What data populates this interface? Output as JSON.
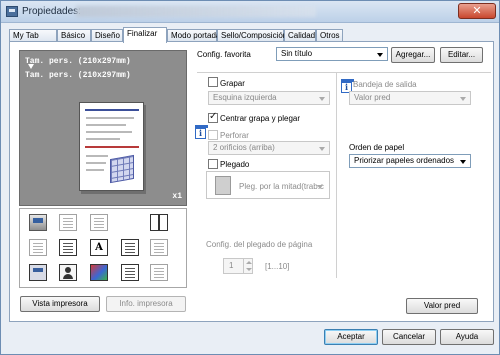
{
  "window": {
    "title": "Propiedades:",
    "close_label": "✕"
  },
  "tabs": [
    {
      "label": "My Tab"
    },
    {
      "label": "Básico"
    },
    {
      "label": "Diseño"
    },
    {
      "label": "Finalizar"
    },
    {
      "label": "Modo portada"
    },
    {
      "label": "Sello/Composición"
    },
    {
      "label": "Calidad"
    },
    {
      "label": "Otros"
    }
  ],
  "preview": {
    "line1": "Tam. pers. (210x297mm)",
    "line2": "Tam. pers. (210x297mm)",
    "copies": "x1"
  },
  "left_buttons": {
    "printer_view": "Vista impresora",
    "printer_info": "Info. impresora"
  },
  "config": {
    "label": "Config. favorita",
    "selected": "Sin título",
    "add_button": "Agregar...",
    "edit_button": "Editar..."
  },
  "staple": {
    "label": "Grapar",
    "position": "Esquina izquierda",
    "center_label": "Centrar grapa y plegar",
    "punch_label": "Perforar",
    "punch_value": "2 orificios (arriba)",
    "fold_label": "Plegado",
    "fold_value": "Pleg. por la mitad(trab.c"
  },
  "output_tray": {
    "label": "Bandeja de salida",
    "value": "Valor pred"
  },
  "paper_order": {
    "label": "Orden de papel",
    "value": "Priorizar papeles ordenados"
  },
  "fold_page": {
    "label": "Config. del plegado de página",
    "value": "1",
    "range": "[1...10]"
  },
  "buttons": {
    "default": "Valor pred",
    "accept": "Aceptar",
    "cancel": "Cancelar",
    "help": "Ayuda"
  }
}
